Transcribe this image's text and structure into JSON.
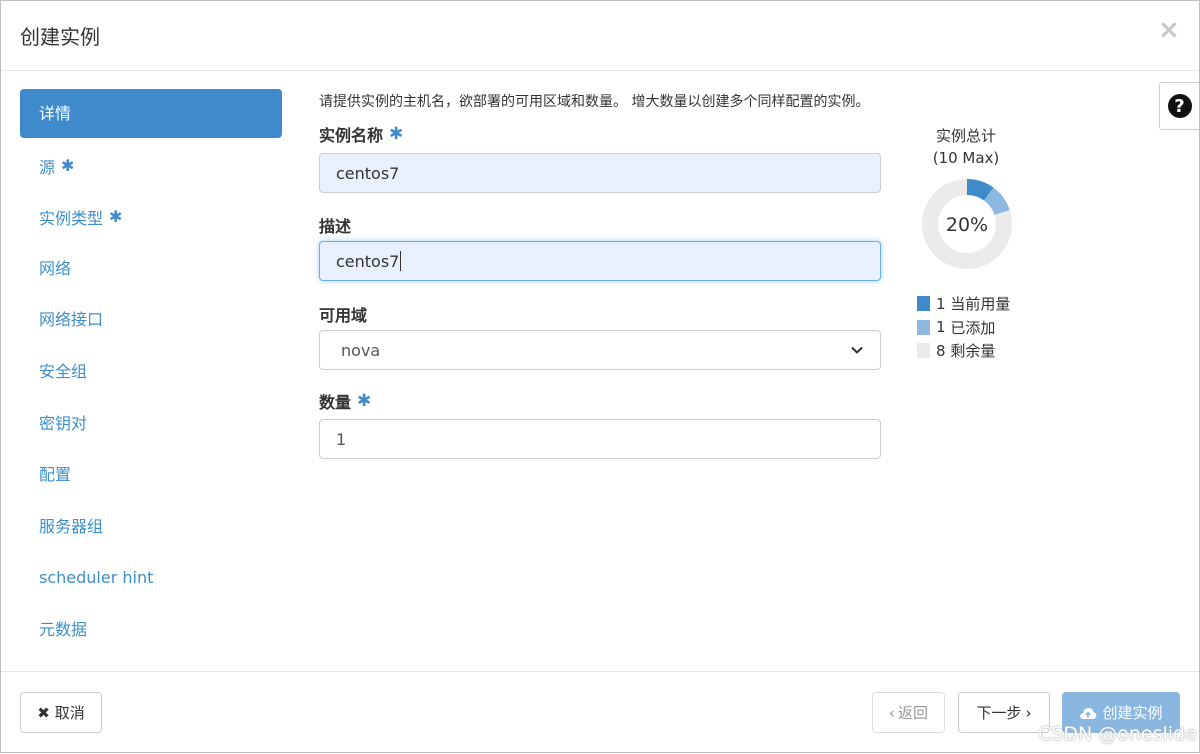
{
  "header": {
    "title": "创建实例",
    "close": "×"
  },
  "help": {
    "icon": "?"
  },
  "sidebar": {
    "items": [
      {
        "label": "详情",
        "required": ""
      },
      {
        "label": "源",
        "required": "✱"
      },
      {
        "label": "实例类型",
        "required": "✱"
      },
      {
        "label": "网络",
        "required": ""
      },
      {
        "label": "网络接口",
        "required": ""
      },
      {
        "label": "安全组",
        "required": ""
      },
      {
        "label": "密钥对",
        "required": ""
      },
      {
        "label": "配置",
        "required": ""
      },
      {
        "label": "服务器组",
        "required": ""
      },
      {
        "label": "scheduler hint",
        "required": ""
      },
      {
        "label": "元数据",
        "required": ""
      }
    ]
  },
  "form": {
    "intro": "请提供实例的主机名，欲部署的可用区域和数量。 增大数量以创建多个同样配置的实例。",
    "name": {
      "label": "实例名称",
      "required": "✱",
      "value": "centos7"
    },
    "description": {
      "label": "描述",
      "value": "centos7"
    },
    "availability_zone": {
      "label": "可用域",
      "value": "nova"
    },
    "count": {
      "label": "数量",
      "required": "✱",
      "value": "1"
    }
  },
  "chart_data": {
    "type": "pie",
    "title": "实例总计",
    "subtitle": "(10 Max)",
    "center_label": "20%",
    "total": 10,
    "slices": [
      {
        "label": "当前用量",
        "value": 1,
        "color": "#3e8acb"
      },
      {
        "label": "已添加",
        "value": 1,
        "color": "#8db9e0"
      },
      {
        "label": "剩余量",
        "value": 8,
        "color": "#ebebeb"
      }
    ]
  },
  "legend": [
    {
      "count": "1",
      "label": "当前用量",
      "color": "#3e8acb"
    },
    {
      "count": "1",
      "label": "已添加",
      "color": "#8db9e0"
    },
    {
      "count": "8",
      "label": "剩余量",
      "color": "#ebebeb"
    }
  ],
  "footer": {
    "cancel": "取消",
    "back": "返回",
    "next": "下一步",
    "create": "创建实例"
  },
  "watermark": "CSDN @oneslide",
  "colors": {
    "accent": "#3e8acb",
    "link": "#3d8fcc",
    "primary_disabled": "#8ab7e0"
  }
}
